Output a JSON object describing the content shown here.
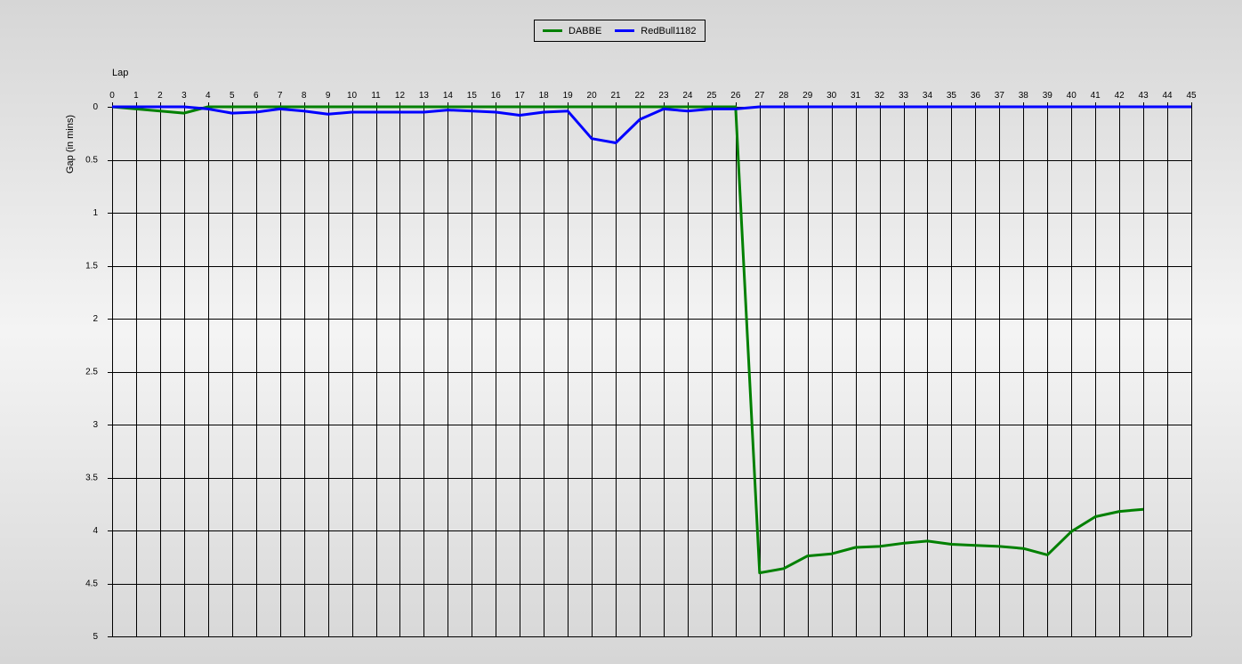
{
  "chart_data": {
    "type": "line",
    "xlabel": "Lap",
    "ylabel": "Gap (in mins)",
    "xlim": [
      0,
      45
    ],
    "ylim": [
      0,
      5
    ],
    "y_inverted": true,
    "x_axis_position": "top",
    "x_ticks": [
      "0",
      "1",
      "2",
      "3",
      "4",
      "5",
      "6",
      "7",
      "8",
      "9",
      "10",
      "11",
      "12",
      "13",
      "14",
      "15",
      "16",
      "17",
      "18",
      "19",
      "20",
      "21",
      "22",
      "23",
      "24",
      "25",
      "26",
      "27",
      "28",
      "29",
      "30",
      "31",
      "32",
      "33",
      "34",
      "35",
      "36",
      "37",
      "38",
      "39",
      "40",
      "41",
      "42",
      "43",
      "44",
      "45"
    ],
    "y_ticks": [
      "0",
      "0.5",
      "1",
      "1.5",
      "2",
      "2.5",
      "3",
      "3.5",
      "4",
      "4.5",
      "5"
    ],
    "y_tick_values": [
      0,
      0.5,
      1,
      1.5,
      2,
      2.5,
      3,
      3.5,
      4,
      4.5,
      5
    ],
    "grid": true,
    "legend_position": "top-center",
    "series": [
      {
        "name": "DABBE",
        "color": "#008000",
        "x": [
          0,
          1,
          2,
          3,
          4,
          5,
          6,
          7,
          8,
          9,
          10,
          11,
          12,
          13,
          14,
          15,
          16,
          17,
          18,
          19,
          20,
          21,
          22,
          23,
          24,
          25,
          26,
          27,
          28,
          29,
          30,
          31,
          32,
          33,
          34,
          35,
          36,
          37,
          38,
          39,
          40,
          41,
          42,
          43
        ],
        "values": [
          0,
          0.02,
          0.04,
          0.06,
          0,
          0,
          0,
          0,
          0,
          0,
          0,
          0,
          0,
          0,
          0,
          0,
          0,
          0,
          0,
          0,
          0,
          0,
          0,
          0,
          0,
          0,
          0,
          4.4,
          4.36,
          4.24,
          4.22,
          4.16,
          4.15,
          4.12,
          4.1,
          4.13,
          4.14,
          4.15,
          4.17,
          4.23,
          4.01,
          3.87,
          3.82,
          3.8
        ]
      },
      {
        "name": "RedBull1182",
        "color": "#0000ff",
        "x": [
          0,
          1,
          2,
          3,
          4,
          5,
          6,
          7,
          8,
          9,
          10,
          11,
          12,
          13,
          14,
          15,
          16,
          17,
          18,
          19,
          20,
          21,
          22,
          23,
          24,
          25,
          26,
          27,
          28,
          29,
          30,
          31,
          32,
          33,
          34,
          35,
          36,
          37,
          38,
          39,
          40,
          41,
          42,
          43,
          44,
          45
        ],
        "values": [
          0,
          0,
          0,
          0,
          0.02,
          0.06,
          0.05,
          0.02,
          0.04,
          0.07,
          0.05,
          0.05,
          0.05,
          0.05,
          0.03,
          0.04,
          0.05,
          0.08,
          0.05,
          0.04,
          0.3,
          0.34,
          0.12,
          0.02,
          0.04,
          0.02,
          0.02,
          0,
          0,
          0,
          0,
          0,
          0,
          0,
          0,
          0,
          0,
          0,
          0,
          0,
          0,
          0,
          0,
          0,
          0,
          0
        ]
      }
    ]
  }
}
